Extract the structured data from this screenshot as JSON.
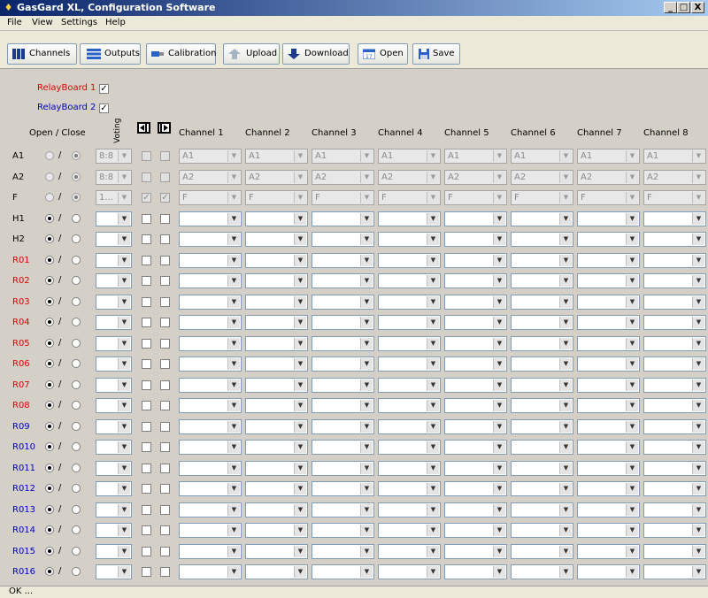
{
  "window": {
    "title": "GasGard XL, Configuration Software",
    "controls": {
      "minimize": "_",
      "maximize": "□",
      "close": "X"
    }
  },
  "menu": [
    "File",
    "View",
    "Settings",
    "Help"
  ],
  "toolbar": {
    "channels": "Channels",
    "outputs": "Outputs",
    "calibration": "Calibration",
    "upload": "Upload",
    "download": "Download",
    "open": "Open",
    "save": "Save"
  },
  "relay_boards": [
    {
      "label": "RelayBoard 1",
      "checked": true,
      "color": "#e00000"
    },
    {
      "label": "RelayBoard 2",
      "checked": true,
      "color": "#0000c0"
    }
  ],
  "header": {
    "open_close": "Open / Close",
    "voting": "Voting",
    "channels": [
      "Channel 1",
      "Channel 2",
      "Channel 3",
      "Channel 4",
      "Channel 5",
      "Channel 6",
      "Channel 7",
      "Channel 8"
    ]
  },
  "rows": [
    {
      "name": "A1",
      "color": "#000000",
      "open": false,
      "disabled": true,
      "voting": "8:8",
      "c1": false,
      "c2": false,
      "channel": "A1"
    },
    {
      "name": "A2",
      "color": "#000000",
      "open": false,
      "disabled": true,
      "voting": "8:8",
      "c1": false,
      "c2": false,
      "channel": "A2"
    },
    {
      "name": "F",
      "color": "#000000",
      "open": false,
      "disabled": true,
      "voting": "1...",
      "c1": true,
      "c2": true,
      "channel": "F"
    },
    {
      "name": "H1",
      "color": "#000000",
      "open": true,
      "disabled": false,
      "voting": "",
      "c1": false,
      "c2": false,
      "channel": ""
    },
    {
      "name": "H2",
      "color": "#000000",
      "open": true,
      "disabled": false,
      "voting": "",
      "c1": false,
      "c2": false,
      "channel": ""
    },
    {
      "name": "R01",
      "color": "#e00000",
      "open": true,
      "disabled": false,
      "voting": "",
      "c1": false,
      "c2": false,
      "channel": ""
    },
    {
      "name": "R02",
      "color": "#e00000",
      "open": true,
      "disabled": false,
      "voting": "",
      "c1": false,
      "c2": false,
      "channel": ""
    },
    {
      "name": "R03",
      "color": "#e00000",
      "open": true,
      "disabled": false,
      "voting": "",
      "c1": false,
      "c2": false,
      "channel": ""
    },
    {
      "name": "R04",
      "color": "#e00000",
      "open": true,
      "disabled": false,
      "voting": "",
      "c1": false,
      "c2": false,
      "channel": ""
    },
    {
      "name": "R05",
      "color": "#e00000",
      "open": true,
      "disabled": false,
      "voting": "",
      "c1": false,
      "c2": false,
      "channel": ""
    },
    {
      "name": "R06",
      "color": "#e00000",
      "open": true,
      "disabled": false,
      "voting": "",
      "c1": false,
      "c2": false,
      "channel": ""
    },
    {
      "name": "R07",
      "color": "#e00000",
      "open": true,
      "disabled": false,
      "voting": "",
      "c1": false,
      "c2": false,
      "channel": ""
    },
    {
      "name": "R08",
      "color": "#e00000",
      "open": true,
      "disabled": false,
      "voting": "",
      "c1": false,
      "c2": false,
      "channel": ""
    },
    {
      "name": "R09",
      "color": "#0000c0",
      "open": true,
      "disabled": false,
      "voting": "",
      "c1": false,
      "c2": false,
      "channel": ""
    },
    {
      "name": "R010",
      "color": "#0000c0",
      "open": true,
      "disabled": false,
      "voting": "",
      "c1": false,
      "c2": false,
      "channel": ""
    },
    {
      "name": "R011",
      "color": "#0000c0",
      "open": true,
      "disabled": false,
      "voting": "",
      "c1": false,
      "c2": false,
      "channel": ""
    },
    {
      "name": "R012",
      "color": "#0000c0",
      "open": true,
      "disabled": false,
      "voting": "",
      "c1": false,
      "c2": false,
      "channel": ""
    },
    {
      "name": "R013",
      "color": "#0000c0",
      "open": true,
      "disabled": false,
      "voting": "",
      "c1": false,
      "c2": false,
      "channel": ""
    },
    {
      "name": "R014",
      "color": "#0000c0",
      "open": true,
      "disabled": false,
      "voting": "",
      "c1": false,
      "c2": false,
      "channel": ""
    },
    {
      "name": "R015",
      "color": "#0000c0",
      "open": true,
      "disabled": false,
      "voting": "",
      "c1": false,
      "c2": false,
      "channel": ""
    },
    {
      "name": "R016",
      "color": "#0000c0",
      "open": true,
      "disabled": false,
      "voting": "",
      "c1": false,
      "c2": false,
      "channel": ""
    }
  ],
  "radio_separator": "/",
  "check_mark": "✓",
  "status": "OK ..."
}
